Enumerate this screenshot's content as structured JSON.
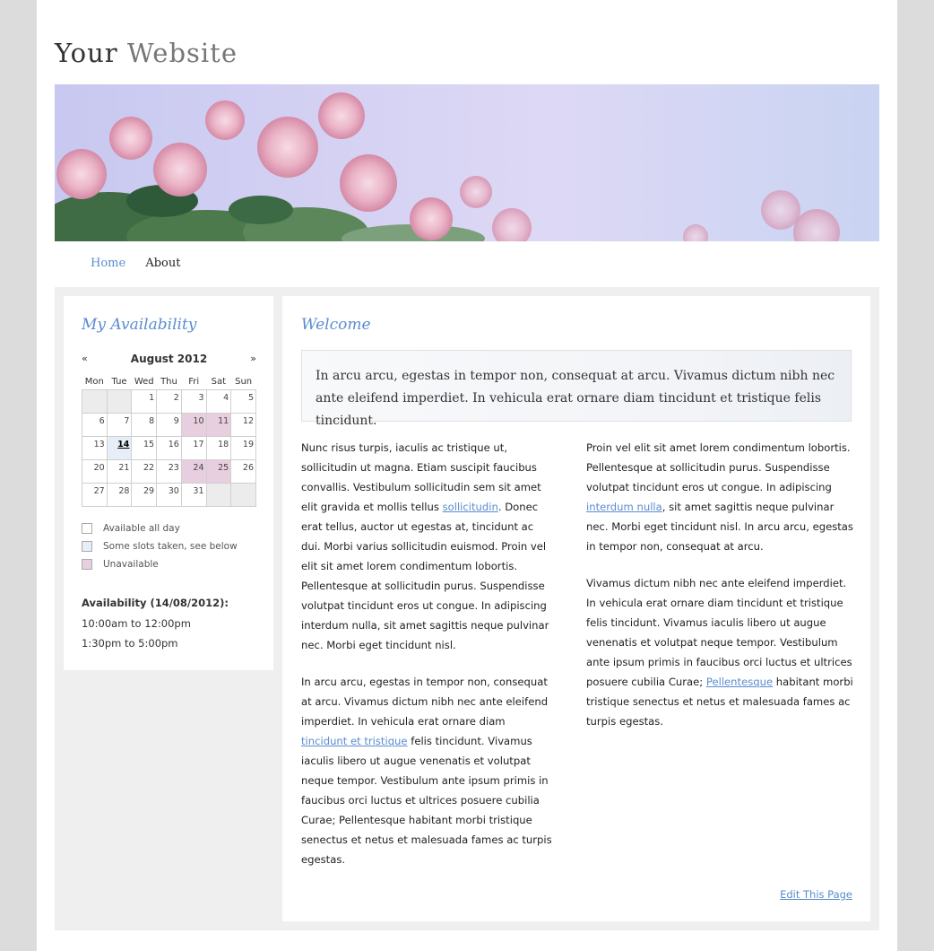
{
  "site": {
    "title_word1": "Your",
    "title_word2": "Website"
  },
  "nav": {
    "home": "Home",
    "about": "About"
  },
  "sidebar": {
    "title": "My Availability",
    "calendar": {
      "prev": "«",
      "next": "»",
      "month": "August 2012",
      "weekdays": [
        "Mon",
        "Tue",
        "Wed",
        "Thu",
        "Fri",
        "Sat",
        "Sun"
      ],
      "weeks": [
        [
          "",
          "",
          "1",
          "2",
          "3",
          "4",
          "5"
        ],
        [
          "6",
          "7",
          "8",
          "9",
          "10",
          "11",
          "12"
        ],
        [
          "13",
          "14",
          "15",
          "16",
          "17",
          "18",
          "19"
        ],
        [
          "20",
          "21",
          "22",
          "23",
          "24",
          "25",
          "26"
        ],
        [
          "27",
          "28",
          "29",
          "30",
          "31",
          "",
          ""
        ]
      ],
      "unavailable_days": [
        "10",
        "11",
        "24",
        "25"
      ],
      "partial_days": [
        "14"
      ],
      "today": "14"
    },
    "legend": {
      "available": "Available all day",
      "partial": "Some slots taken, see below",
      "unavailable": "Unavailable"
    },
    "availability_title": "Availability (14/08/2012):",
    "slots": [
      "10:00am to 12:00pm",
      "1:30pm to 5:00pm"
    ]
  },
  "main": {
    "title": "Welcome",
    "intro": "In arcu arcu, egestas in tempor non, consequat at arcu. Vivamus dictum nibh nec ante eleifend imperdiet. In vehicula erat ornare diam tincidunt et tristique felis tincidunt.",
    "col1_p1_a": "Nunc risus turpis, iaculis ac tristique ut, sollicitudin ut magna. Etiam suscipit faucibus convallis. Vestibulum sollicitudin sem sit amet elit gravida et mollis tellus ",
    "col1_p1_link": "sollicitudin",
    "col1_p1_b": ". Donec erat tellus, auctor ut egestas at, tincidunt ac dui. Morbi varius sollicitudin euismod. Proin vel elit sit amet lorem condimentum lobortis. Pellentesque at sollicitudin purus. Suspendisse volutpat tincidunt eros ut congue. In adipiscing interdum nulla, sit amet sagittis neque pulvinar nec. Morbi eget tincidunt nisl.",
    "col1_p2_a": "In arcu arcu, egestas in tempor non, consequat at arcu. Vivamus dictum nibh nec ante eleifend imperdiet. In vehicula erat ornare diam ",
    "col1_p2_link": "tincidunt et tristique",
    "col1_p2_b": " felis tincidunt. Vivamus iaculis libero ut augue venenatis et volutpat neque tempor. Vestibulum ante ipsum primis in faucibus orci luctus et ultrices posuere cubilia Curae; Pellentesque habitant morbi tristique senectus et netus et malesuada fames ac turpis egestas.",
    "col2_p1_a": "Proin vel elit sit amet lorem condimentum lobortis. Pellentesque at sollicitudin purus. Suspendisse volutpat tincidunt eros ut congue. In adipiscing ",
    "col2_p1_link": "interdum nulla",
    "col2_p1_b": ", sit amet sagittis neque pulvinar nec. Morbi eget tincidunt nisl. In arcu arcu, egestas in tempor non, consequat at arcu.",
    "col2_p2_a": "Vivamus dictum nibh nec ante eleifend imperdiet. In vehicula erat ornare diam tincidunt et tristique felis tincidunt. Vivamus iaculis libero ut augue venenatis et volutpat neque tempor. Vestibulum ante ipsum primis in faucibus orci luctus et ultrices posuere cubilia Curae; ",
    "col2_p2_link": "Pellentesque",
    "col2_p2_b": " habitant morbi tristique senectus et netus et malesuada fames ac turpis egestas.",
    "edit": "Edit This Page"
  },
  "colors": {
    "accent": "#5a8ccf",
    "unavailable": "#e8cfe0",
    "partial": "#e6eef8",
    "empty_cell": "#ececec",
    "page_bg": "#dcdcdc"
  }
}
